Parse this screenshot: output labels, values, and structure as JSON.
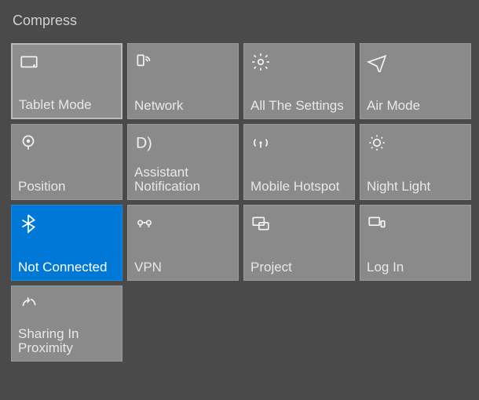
{
  "header": "Compress",
  "tiles": [
    {
      "label": "Tablet Mode",
      "icon": "tablet-icon",
      "state": "selected"
    },
    {
      "label": "Network",
      "icon": "wifi-icon",
      "state": "normal"
    },
    {
      "label": "All The Settings",
      "icon": "gear-icon",
      "state": "normal"
    },
    {
      "label": "Air Mode",
      "icon": "airplane-icon",
      "state": "normal"
    },
    {
      "label": "Position",
      "icon": "location-icon",
      "state": "normal"
    },
    {
      "label": "Assistant Notification",
      "icon": "moon-icon",
      "state": "normal"
    },
    {
      "label": "Mobile Hotspot",
      "icon": "hotspot-icon",
      "state": "normal"
    },
    {
      "label": "Night Light",
      "icon": "sun-icon",
      "state": "normal"
    },
    {
      "label": "Not Connected",
      "icon": "bluetooth-icon",
      "state": "active"
    },
    {
      "label": "VPN",
      "icon": "vpn-icon",
      "state": "normal"
    },
    {
      "label": "Project",
      "icon": "project-icon",
      "state": "normal"
    },
    {
      "label": "Log In",
      "icon": "connect-icon",
      "state": "normal"
    },
    {
      "label": "Sharing In Proximity",
      "icon": "share-icon",
      "state": "normal"
    }
  ]
}
